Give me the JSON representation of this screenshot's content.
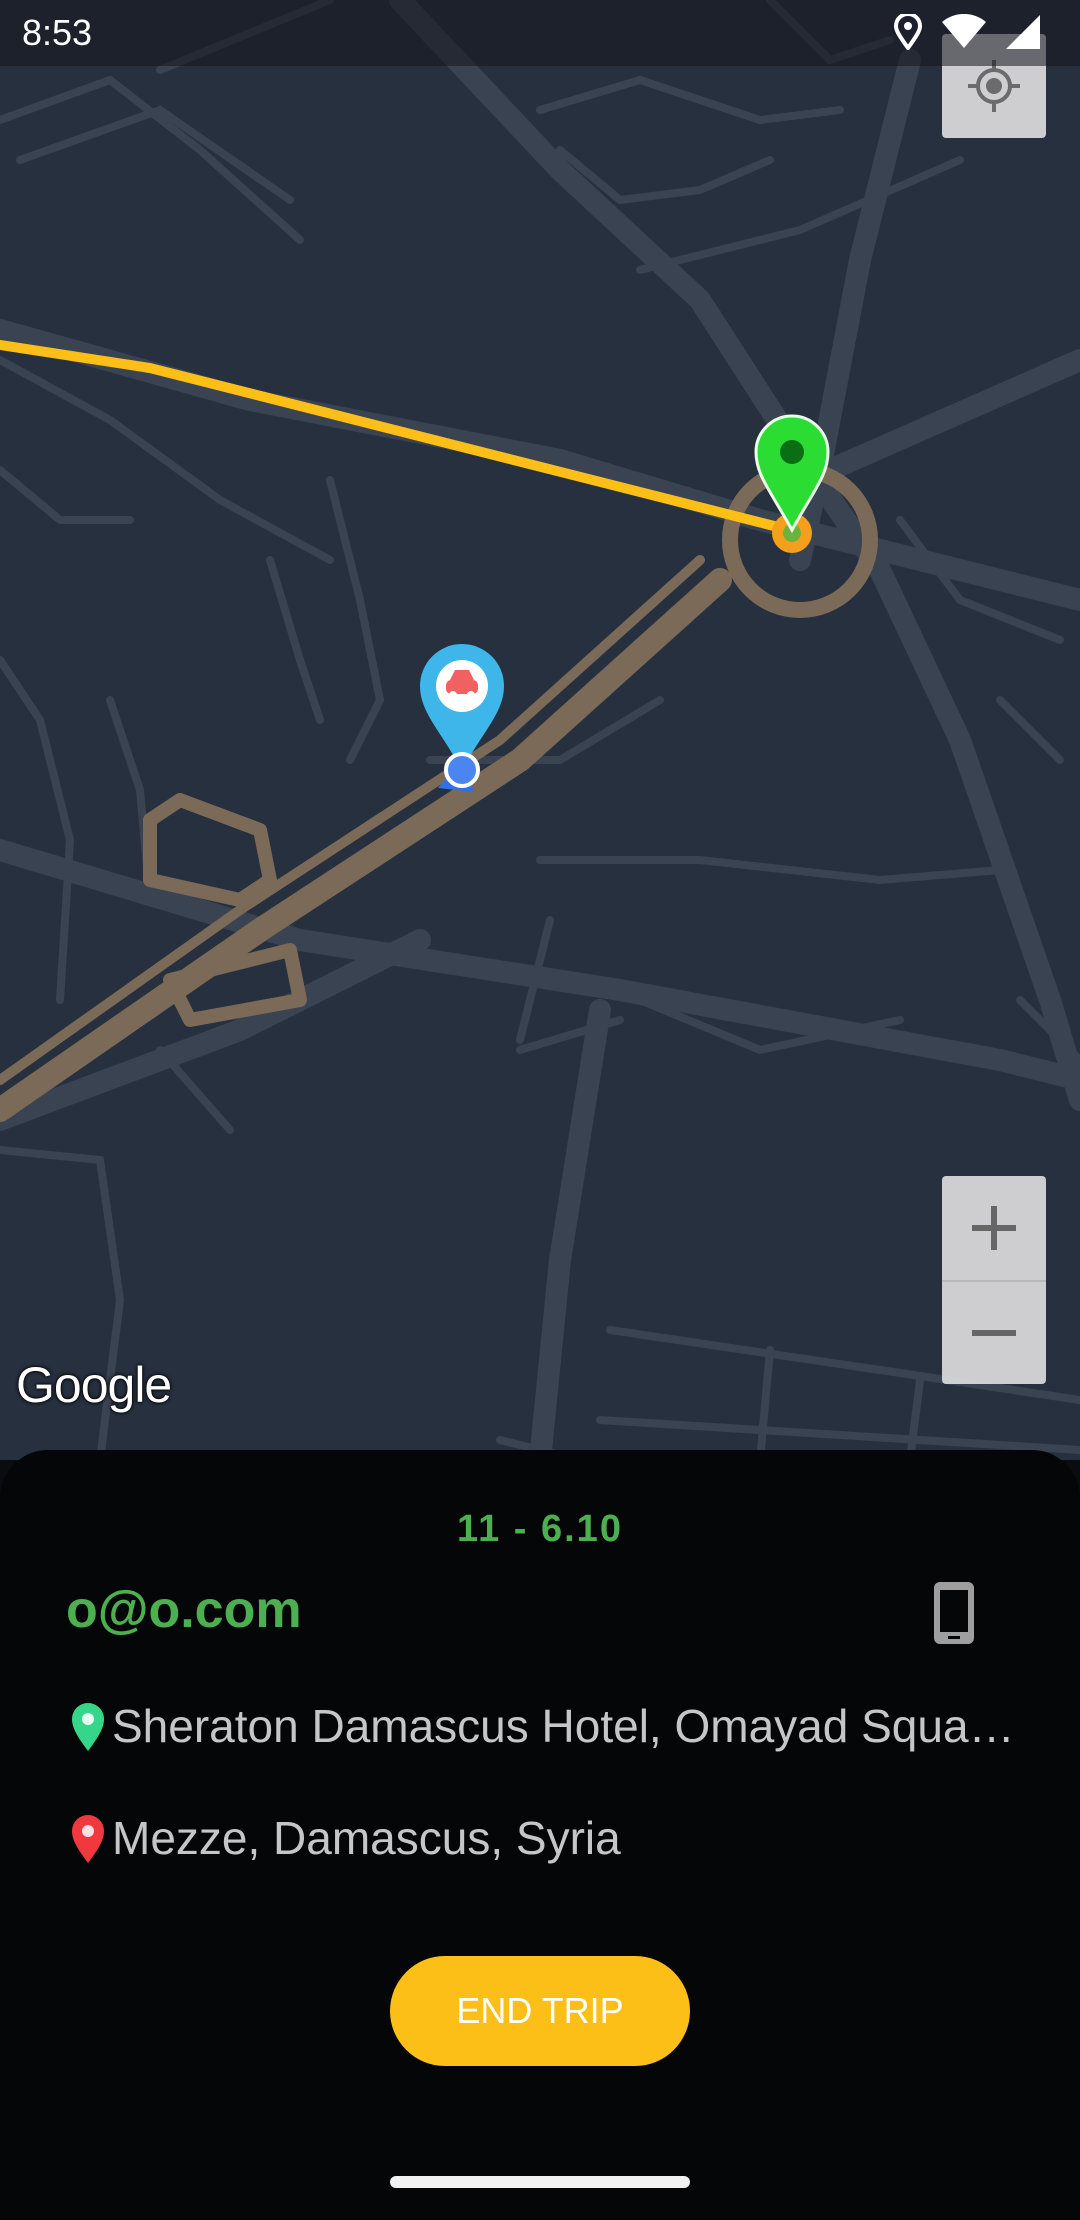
{
  "status_bar": {
    "time": "8:53",
    "icons": [
      "location-icon",
      "wifi-icon",
      "signal-icon"
    ]
  },
  "map": {
    "background_color": "#27303f",
    "road_color": "#3a4352",
    "route_color": "#fbbf18",
    "highway_color": "#7a6a57",
    "attribution": "Google"
  },
  "trip": {
    "fare": "11 - 6.10",
    "passenger_email": "o@o.com",
    "pickup_address": "Sheraton Damascus Hotel, Omayad Square, Damascus, Syria",
    "dropoff_address": "Mezze, Damascus, Syria",
    "end_button_label": "END TRIP"
  },
  "colors": {
    "accent_green": "#4caf50",
    "accent_yellow": "#fbbf18",
    "sheet_bg": "#050608",
    "address_text": "#c6c6c6"
  }
}
